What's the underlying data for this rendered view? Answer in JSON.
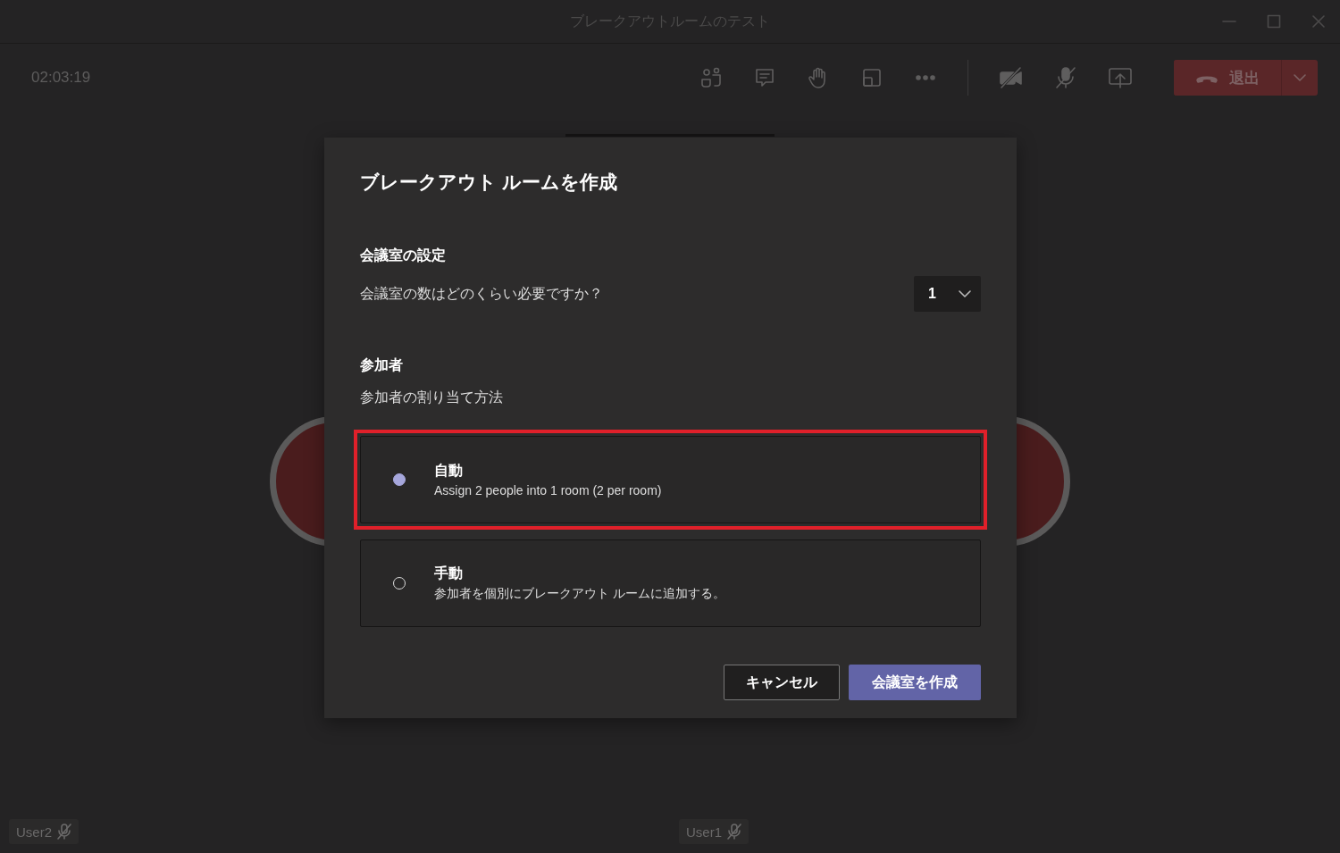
{
  "window": {
    "title": "ブレークアウトルームのテスト"
  },
  "toolbar": {
    "timer": "02:03:19",
    "leave_button": {
      "label": "退出"
    }
  },
  "dialog": {
    "title": "ブレークアウト ルームを作成",
    "room_settings": {
      "heading": "会議室の設定",
      "question": "会議室の数はどのくらい必要ですか？",
      "count": "1"
    },
    "participants": {
      "heading": "参加者",
      "subheading": "参加者の割り当て方法",
      "options": [
        {
          "label": "自動",
          "description": "Assign 2 people into 1 room (2 per room)",
          "selected": true,
          "highlighted": true
        },
        {
          "label": "手動",
          "description": "参加者を個別にブレークアウト ルームに追加する。",
          "selected": false,
          "highlighted": false
        }
      ]
    },
    "buttons": [
      {
        "label": "キャンセル",
        "kind": "secondary"
      },
      {
        "label": "会議室を作成",
        "kind": "primary"
      }
    ]
  },
  "tiles": [
    {
      "name": "User2",
      "muted": true
    },
    {
      "name": "User1",
      "muted": true
    }
  ]
}
